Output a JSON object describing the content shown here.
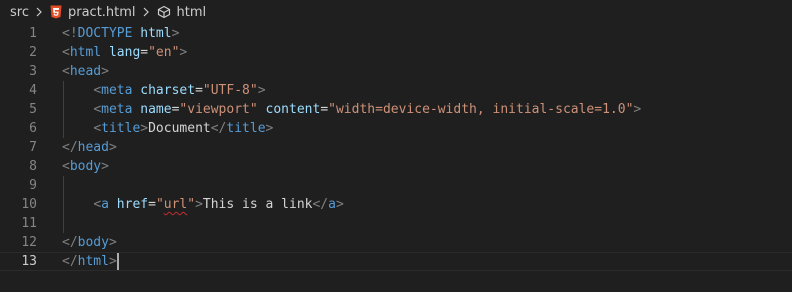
{
  "breadcrumb": {
    "folder": "src",
    "file": "pract.html",
    "symbol": "html",
    "colors": {
      "html_icon": "#e44d26",
      "symbol_icon": "#cccccc"
    },
    "icons": [
      "chevron-right-icon",
      "html5-file-icon",
      "symbol-element-icon"
    ]
  },
  "editor": {
    "active_line": "13",
    "line_numbers": [
      "1",
      "2",
      "3",
      "4",
      "5",
      "6",
      "7",
      "8",
      "9",
      "10",
      "11",
      "12",
      "13"
    ],
    "colors": {
      "background": "#1f1f1f",
      "tag": "#569cd6",
      "attribute": "#9cdcfe",
      "string": "#ce9178",
      "bracket": "#808080",
      "text": "#d4d4d4",
      "line_number": "#858585"
    },
    "lines": [
      [
        {
          "c": "t-brk",
          "t": "<!"
        },
        {
          "c": "t-tag",
          "t": "DOCTYPE"
        },
        {
          "c": "t-txt",
          "t": " "
        },
        {
          "c": "t-attr",
          "t": "html"
        },
        {
          "c": "t-brk",
          "t": ">"
        }
      ],
      [
        {
          "c": "t-brk",
          "t": "<"
        },
        {
          "c": "t-tag",
          "t": "html"
        },
        {
          "c": "t-txt",
          "t": " "
        },
        {
          "c": "t-attr",
          "t": "lang"
        },
        {
          "c": "t-txt",
          "t": "="
        },
        {
          "c": "t-str",
          "t": "\"en\""
        },
        {
          "c": "t-brk",
          "t": ">"
        }
      ],
      [
        {
          "c": "t-brk",
          "t": "<"
        },
        {
          "c": "t-tag",
          "t": "head"
        },
        {
          "c": "t-brk",
          "t": ">"
        }
      ],
      [
        {
          "c": "t-txt",
          "t": "    "
        },
        {
          "c": "t-brk",
          "t": "<"
        },
        {
          "c": "t-tag",
          "t": "meta"
        },
        {
          "c": "t-txt",
          "t": " "
        },
        {
          "c": "t-attr",
          "t": "charset"
        },
        {
          "c": "t-txt",
          "t": "="
        },
        {
          "c": "t-str",
          "t": "\"UTF-8\""
        },
        {
          "c": "t-brk",
          "t": ">"
        }
      ],
      [
        {
          "c": "t-txt",
          "t": "    "
        },
        {
          "c": "t-brk",
          "t": "<"
        },
        {
          "c": "t-tag",
          "t": "meta"
        },
        {
          "c": "t-txt",
          "t": " "
        },
        {
          "c": "t-attr",
          "t": "name"
        },
        {
          "c": "t-txt",
          "t": "="
        },
        {
          "c": "t-str",
          "t": "\"viewport\""
        },
        {
          "c": "t-txt",
          "t": " "
        },
        {
          "c": "t-attr",
          "t": "content"
        },
        {
          "c": "t-txt",
          "t": "="
        },
        {
          "c": "t-str",
          "t": "\"width=device-width, initial-scale=1.0\""
        },
        {
          "c": "t-brk",
          "t": ">"
        }
      ],
      [
        {
          "c": "t-txt",
          "t": "    "
        },
        {
          "c": "t-brk",
          "t": "<"
        },
        {
          "c": "t-tag",
          "t": "title"
        },
        {
          "c": "t-brk",
          "t": ">"
        },
        {
          "c": "t-txt",
          "t": "Document"
        },
        {
          "c": "t-brk",
          "t": "</"
        },
        {
          "c": "t-tag",
          "t": "title"
        },
        {
          "c": "t-brk",
          "t": ">"
        }
      ],
      [
        {
          "c": "t-brk",
          "t": "</"
        },
        {
          "c": "t-tag",
          "t": "head"
        },
        {
          "c": "t-brk",
          "t": ">"
        }
      ],
      [
        {
          "c": "t-brk",
          "t": "<"
        },
        {
          "c": "t-tag",
          "t": "body"
        },
        {
          "c": "t-brk",
          "t": ">"
        }
      ],
      [],
      [
        {
          "c": "t-txt",
          "t": "    "
        },
        {
          "c": "t-brk",
          "t": "<"
        },
        {
          "c": "t-tag",
          "t": "a"
        },
        {
          "c": "t-txt",
          "t": " "
        },
        {
          "c": "t-attr",
          "t": "href"
        },
        {
          "c": "t-txt",
          "t": "="
        },
        {
          "c": "t-str",
          "t": "\""
        },
        {
          "c": "t-str squiggle",
          "t": "url"
        },
        {
          "c": "t-str",
          "t": "\""
        },
        {
          "c": "t-brk",
          "t": ">"
        },
        {
          "c": "t-txt",
          "t": "This is a link"
        },
        {
          "c": "t-brk",
          "t": "</"
        },
        {
          "c": "t-tag",
          "t": "a"
        },
        {
          "c": "t-brk",
          "t": ">"
        }
      ],
      [],
      [
        {
          "c": "t-brk",
          "t": "</"
        },
        {
          "c": "t-tag",
          "t": "body"
        },
        {
          "c": "t-brk",
          "t": ">"
        }
      ],
      [
        {
          "c": "t-brk",
          "t": "</"
        },
        {
          "c": "t-tag",
          "t": "html"
        },
        {
          "c": "t-brk",
          "t": ">"
        }
      ]
    ]
  }
}
